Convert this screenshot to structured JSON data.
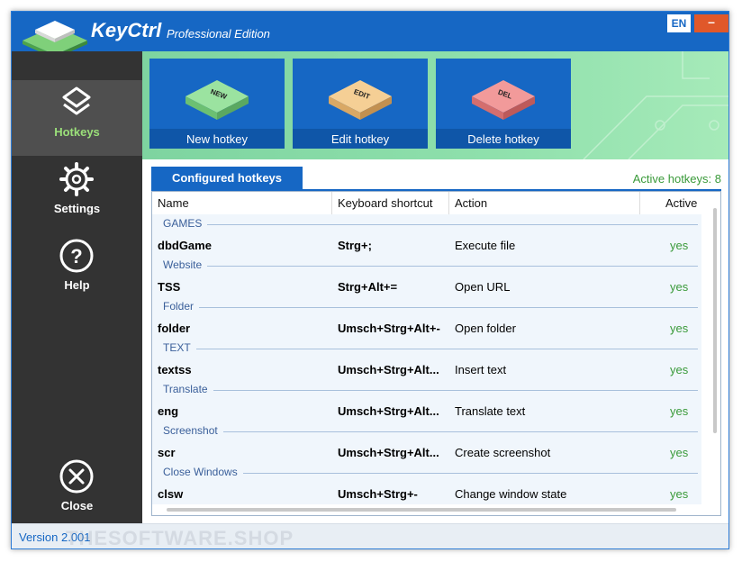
{
  "titlebar": {
    "app_name": "KeyCtrl",
    "edition": "Professional Edition",
    "language": "EN",
    "minimize_symbol": "–"
  },
  "sidebar": {
    "items": [
      {
        "label": "Hotkeys",
        "icon": "layers-icon",
        "active": true
      },
      {
        "label": "Settings",
        "icon": "gear-icon",
        "active": false
      },
      {
        "label": "Help",
        "icon": "help-icon",
        "active": false
      },
      {
        "label": "Close",
        "icon": "close-icon",
        "active": false
      }
    ]
  },
  "toolbar": {
    "new": {
      "label": "New hotkey",
      "key_text": "NEW",
      "color": "#9be3a0"
    },
    "edit": {
      "label": "Edit hotkey",
      "key_text": "EDIT",
      "color": "#f5cf95"
    },
    "delete": {
      "label": "Delete hotkey",
      "key_text": "DEL",
      "color": "#f29a9a"
    }
  },
  "hotkeys": {
    "tab_label": "Configured hotkeys",
    "active_count": "Active hotkeys: 8",
    "columns": {
      "name": "Name",
      "shortcut": "Keyboard shortcut",
      "action": "Action",
      "active": "Active"
    },
    "groups": [
      {
        "group": "GAMES",
        "name": "dbdGame",
        "shortcut": "Strg+;",
        "action": "Execute file",
        "active": "yes"
      },
      {
        "group": "Website",
        "name": "TSS",
        "shortcut": "Strg+Alt+=",
        "action": "Open URL",
        "active": "yes"
      },
      {
        "group": "Folder",
        "name": "folder",
        "shortcut": "Umsch+Strg+Alt+-",
        "action": "Open folder",
        "active": "yes"
      },
      {
        "group": "TEXT",
        "name": "textss",
        "shortcut": "Umsch+Strg+Alt...",
        "action": "Insert text",
        "active": "yes"
      },
      {
        "group": "Translate",
        "name": "eng",
        "shortcut": "Umsch+Strg+Alt...",
        "action": "Translate text",
        "active": "yes"
      },
      {
        "group": "Screenshot",
        "name": "scr",
        "shortcut": "Umsch+Strg+Alt...",
        "action": "Create screenshot",
        "active": "yes"
      },
      {
        "group": "Close Windows",
        "name": "clsw",
        "shortcut": "Umsch+Strg+-",
        "action": "Change window state",
        "active": "yes"
      }
    ]
  },
  "status": {
    "version": "Version 2.001",
    "watermark": "THESOFTWARE.SHOP"
  }
}
